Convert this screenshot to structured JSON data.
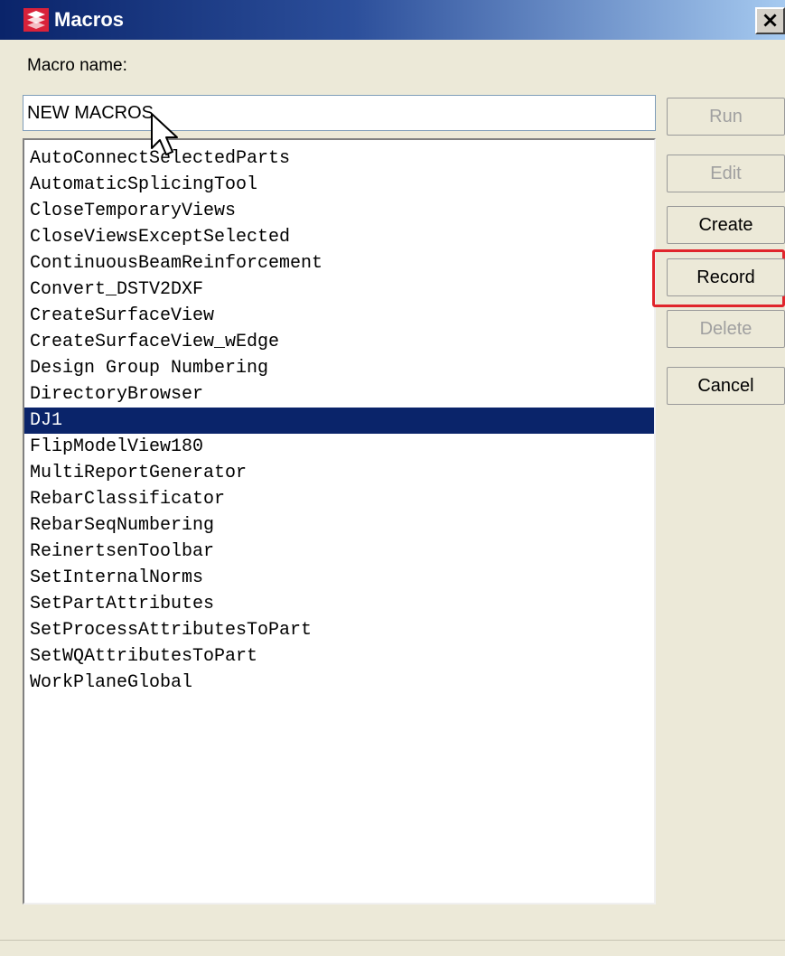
{
  "window": {
    "title": "Macros",
    "close_glyph": "×"
  },
  "form": {
    "macro_name_label": "Macro name:",
    "macro_name_value": "NEW MACROS"
  },
  "macros": {
    "selected": "DJ1",
    "items": [
      "AutoConnectSelectedParts",
      "AutomaticSplicingTool",
      "CloseTemporaryViews",
      "CloseViewsExceptSelected",
      "ContinuousBeamReinforcement",
      "Convert_DSTV2DXF",
      "CreateSurfaceView",
      "CreateSurfaceView_wEdge",
      "Design Group Numbering",
      "DirectoryBrowser",
      "DJ1",
      "FlipModelView180",
      "MultiReportGenerator",
      "RebarClassificator",
      "RebarSeqNumbering",
      "ReinertsenToolbar",
      "SetInternalNorms",
      "SetPartAttributes",
      "SetProcessAttributesToPart",
      "SetWQAttributesToPart",
      "WorkPlaneGlobal"
    ]
  },
  "buttons": {
    "run": "Run",
    "edit": "Edit",
    "create": "Create",
    "record": "Record",
    "delete": "Delete",
    "cancel": "Cancel"
  },
  "icons": {
    "app": "macros-app-icon",
    "close": "close-icon",
    "cursor": "mouse-pointer-icon"
  },
  "colors": {
    "title_gradient_start": "#0a246a",
    "title_gradient_end": "#a6caf0",
    "selection": "#0a246a",
    "highlight": "#e0252c",
    "disabled_text": "#a0a0a0"
  }
}
